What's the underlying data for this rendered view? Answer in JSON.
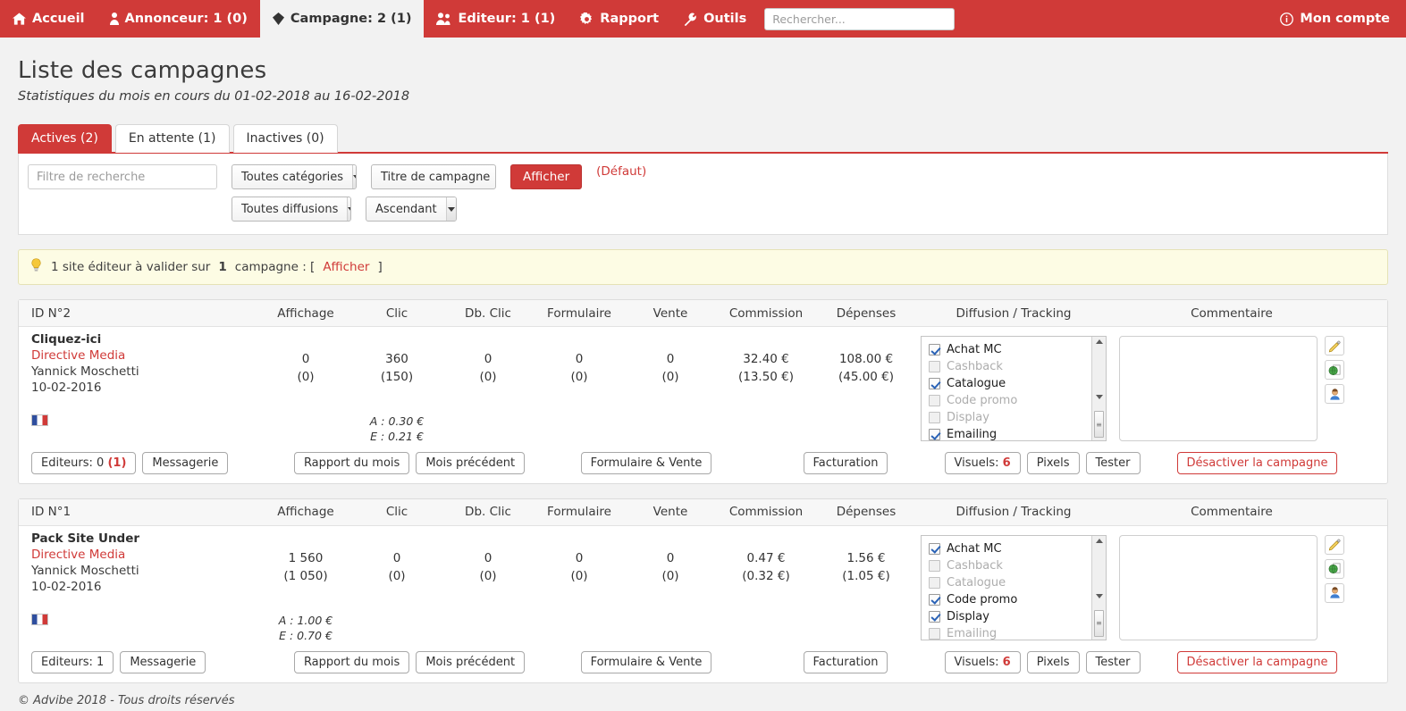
{
  "navbar": {
    "items": [
      {
        "label": "Accueil",
        "icon": "home-icon",
        "active": false
      },
      {
        "label": "Annonceur: 1 (0)",
        "icon": "user-icon",
        "active": false
      },
      {
        "label": "Campagne: 2 (1)",
        "icon": "tag-icon",
        "active": true
      },
      {
        "label": "Editeur: 1 (1)",
        "icon": "users-icon",
        "active": false
      },
      {
        "label": "Rapport",
        "icon": "gear-icon",
        "active": false
      },
      {
        "label": "Outils",
        "icon": "wrench-icon",
        "active": false
      }
    ],
    "search_placeholder": "Rechercher...",
    "account_label": "Mon compte",
    "account_icon": "info-circle-icon",
    "brand_color": "#d03a38"
  },
  "header": {
    "title": "Liste des campagnes",
    "subtitle": "Statistiques du mois en cours du 01-02-2018 au 16-02-2018"
  },
  "tabs": [
    {
      "label": "Actives (2)",
      "active": true
    },
    {
      "label": "En attente (1)",
      "active": false
    },
    {
      "label": "Inactives (0)",
      "active": false
    }
  ],
  "filters": {
    "search_placeholder": "Filtre de recherche",
    "search_value": "",
    "category_select": "Toutes catégories",
    "diffusion_select": "Toutes diffusions",
    "sort_field_select": "Titre de campagne",
    "sort_order_select": "Ascendant",
    "submit_label": "Afficher",
    "default_label": "(Défaut)"
  },
  "alert": {
    "icon": "lightbulb-icon",
    "text_before": "1 site éditeur à valider sur ",
    "count": "1",
    "text_after": " campagne : [",
    "link_label": "Afficher",
    "text_end": "]"
  },
  "table_headers": {
    "affichage": "Affichage",
    "clic": "Clic",
    "db_clic": "Db. Clic",
    "formulaire": "Formulaire",
    "vente": "Vente",
    "commission": "Commission",
    "depenses": "Dépenses",
    "diffusion": "Diffusion / Tracking",
    "commentaire": "Commentaire"
  },
  "campaigns": [
    {
      "id_label": "ID N°2",
      "name": "Cliquez-ici",
      "advertiser": "Directive Media",
      "contact": "Yannick Moschetti",
      "date": "10-02-2016",
      "country_flag": "france-flag-icon",
      "stats": {
        "affichage": {
          "main": "0",
          "sub": "(0)",
          "price": ""
        },
        "clic": {
          "main": "360",
          "sub": "(150)",
          "price_a": "A : 0.30 €",
          "price_e": "E : 0.21 €"
        },
        "db_clic": {
          "main": "0",
          "sub": "(0)"
        },
        "formulaire": {
          "main": "0",
          "sub": "(0)"
        },
        "vente": {
          "main": "0",
          "sub": "(0)"
        },
        "commission": {
          "main": "32.40 €",
          "sub": "(13.50 €)"
        },
        "depenses": {
          "main": "108.00 €",
          "sub": "(45.00 €)"
        }
      },
      "diffusion": [
        {
          "label": "Achat MC",
          "checked": true
        },
        {
          "label": "Cashback",
          "checked": false
        },
        {
          "label": "Catalogue",
          "checked": true
        },
        {
          "label": "Code promo",
          "checked": false
        },
        {
          "label": "Display",
          "checked": false
        },
        {
          "label": "Emailing",
          "checked": true
        }
      ],
      "comment_value": "",
      "side_icons": [
        "edit-pencil-icon",
        "globe-page-icon",
        "user-avatar-icon"
      ],
      "actions": {
        "editeurs_label": "Editeurs: 0 ",
        "editeurs_count": "(1)",
        "messagerie": "Messagerie",
        "rapport_du_mois": "Rapport du mois",
        "mois_precedent": "Mois précédent",
        "formulaire_vente": "Formulaire & Vente",
        "facturation": "Facturation",
        "visuels_label": "Visuels: ",
        "visuels_count": "6",
        "pixels": "Pixels",
        "tester": "Tester",
        "desactiver": "Désactiver la campagne"
      }
    },
    {
      "id_label": "ID N°1",
      "name": "Pack Site Under",
      "advertiser": "Directive Media",
      "contact": "Yannick Moschetti",
      "date": "10-02-2016",
      "country_flag": "france-flag-icon",
      "stats": {
        "affichage": {
          "main": "1 560",
          "sub": "(1 050)",
          "price_a": "A : 1.00 €",
          "price_e": "E : 0.70 €"
        },
        "clic": {
          "main": "0",
          "sub": "(0)"
        },
        "db_clic": {
          "main": "0",
          "sub": "(0)"
        },
        "formulaire": {
          "main": "0",
          "sub": "(0)"
        },
        "vente": {
          "main": "0",
          "sub": "(0)"
        },
        "commission": {
          "main": "0.47 €",
          "sub": "(0.32 €)"
        },
        "depenses": {
          "main": "1.56 €",
          "sub": "(1.05 €)"
        }
      },
      "diffusion": [
        {
          "label": "Achat MC",
          "checked": true
        },
        {
          "label": "Cashback",
          "checked": false
        },
        {
          "label": "Catalogue",
          "checked": false
        },
        {
          "label": "Code promo",
          "checked": true
        },
        {
          "label": "Display",
          "checked": true
        },
        {
          "label": "Emailing",
          "checked": false
        }
      ],
      "comment_value": "",
      "side_icons": [
        "edit-pencil-icon",
        "globe-page-icon",
        "user-avatar-icon"
      ],
      "actions": {
        "editeurs_label": "Editeurs: 1",
        "editeurs_count": "",
        "messagerie": "Messagerie",
        "rapport_du_mois": "Rapport du mois",
        "mois_precedent": "Mois précédent",
        "formulaire_vente": "Formulaire & Vente",
        "facturation": "Facturation",
        "visuels_label": "Visuels: ",
        "visuels_count": "6",
        "pixels": "Pixels",
        "tester": "Tester",
        "desactiver": "Désactiver la campagne"
      }
    }
  ],
  "footer": {
    "text": "© Advibe 2018 - Tous droits réservés"
  }
}
